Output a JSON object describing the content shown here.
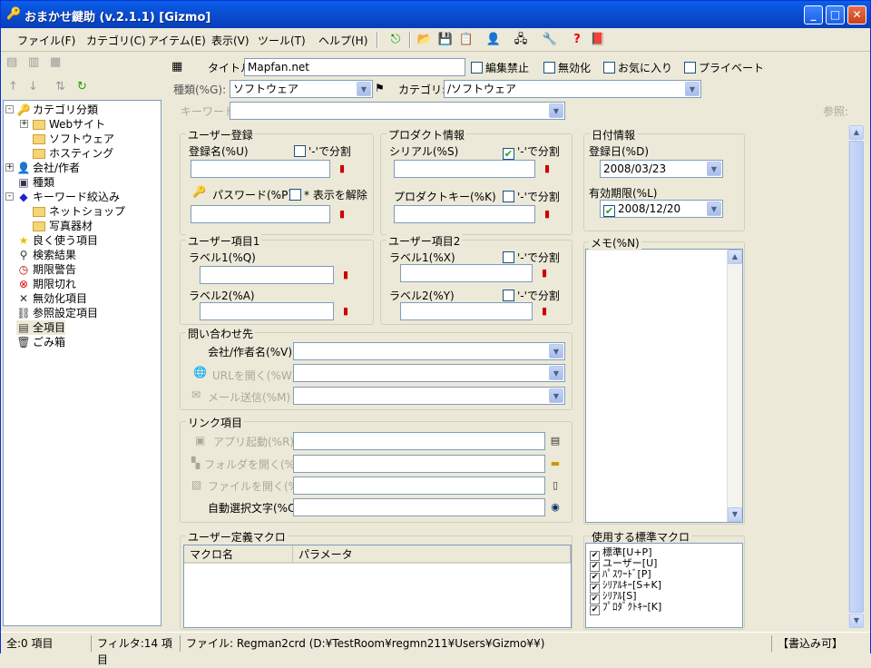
{
  "window": {
    "title": "おまかせ鍵助 (v.2.1.1) [Gizmo]"
  },
  "menu": [
    "ファイル(F)",
    "カテゴリ(C)",
    "アイテム(E)",
    "表示(V)",
    "ツール(T)",
    "ヘルプ(H)"
  ],
  "tree": {
    "items": [
      {
        "label": "カテゴリ分類",
        "icon": "key-icon",
        "level": 0,
        "exp": "-"
      },
      {
        "label": "Webサイト",
        "icon": "folder-icon",
        "level": 1,
        "exp": "+"
      },
      {
        "label": "ソフトウェア",
        "icon": "folder-icon",
        "level": 1
      },
      {
        "label": "ホスティング",
        "icon": "folder-icon",
        "level": 1
      },
      {
        "label": "会社/作者",
        "icon": "person-icon",
        "level": 0,
        "exp": "+"
      },
      {
        "label": "種類",
        "icon": "card-icon",
        "level": 0
      },
      {
        "label": "キーワード絞込み",
        "icon": "tag-icon",
        "level": 0,
        "exp": "-"
      },
      {
        "label": "ネットショップ",
        "icon": "folder-icon",
        "level": 1
      },
      {
        "label": "写真器材",
        "icon": "folder-icon",
        "level": 1
      },
      {
        "label": "良く使う項目",
        "icon": "star-icon",
        "level": 0
      },
      {
        "label": "検索結果",
        "icon": "binoculars-icon",
        "level": 0
      },
      {
        "label": "期限警告",
        "icon": "clock-icon",
        "level": 0
      },
      {
        "label": "期限切れ",
        "icon": "expired-icon",
        "level": 0
      },
      {
        "label": "無効化項目",
        "icon": "cross-icon",
        "level": 0
      },
      {
        "label": "参照設定項目",
        "icon": "link-icon",
        "level": 0
      },
      {
        "label": "全項目",
        "icon": "pages-icon",
        "level": 0
      },
      {
        "label": "ごみ箱",
        "icon": "trash-icon",
        "level": 0
      }
    ]
  },
  "top": {
    "title_label": "タイトル(%T):",
    "title_value": "Mapfan.net",
    "lock_label": "編集禁止",
    "disable_label": "無効化",
    "fav_label": "お気に入り",
    "private_label": "プライベート",
    "type_label": "種類(%G):",
    "type_value": "ソフトウェア",
    "cat_label": "カテゴリ:",
    "cat_value": "/ソフトウェア",
    "kw_label": "キーワード",
    "ref_label": "参照:"
  },
  "user": {
    "group": "ユーザー登録",
    "name_label": "登録名(%U)",
    "split_label": "'-'で分割",
    "pw_label": "パスワード(%P)",
    "mask_label": "* 表示を解除"
  },
  "product": {
    "group": "プロダクト情報",
    "serial_label": "シリアル(%S)",
    "split_label": "'-'で分割",
    "pkey_label": "プロダクトキー(%K)",
    "split2_label": "'-'で分割"
  },
  "date": {
    "group": "日付情報",
    "reg_label": "登録日(%D)",
    "reg_value": "2008/03/23",
    "exp_label": "有効期限(%L)",
    "exp_value": "2008/12/20"
  },
  "uitem1": {
    "group": "ユーザー項目1",
    "l1": "ラベル1(%Q)",
    "l2": "ラベル2(%A)"
  },
  "uitem2": {
    "group": "ユーザー項目2",
    "l1": "ラベル1(%X)",
    "l2": "ラベル2(%Y)",
    "split": "'-'で分割"
  },
  "memo": {
    "label": "メモ(%N)"
  },
  "contact": {
    "group": "問い合わせ先",
    "company_label": "会社/作者名(%V):",
    "url_label": "URLを開く(%W)",
    "mail_label": "メール送信(%M)"
  },
  "link": {
    "group": "リンク項目",
    "app_label": "アプリ起動(%R)",
    "folder_label": "フォルダを開く(%F)",
    "file_label": "ファイルを開く(%O)",
    "auto_label": "自動選択文字(%C):"
  },
  "macro": {
    "group": "ユーザー定義マクロ",
    "col_name": "マクロ名",
    "col_param": "パラメータ"
  },
  "std": {
    "group": "使用する標準マクロ",
    "items": [
      "標準[U+P]",
      "ユーザー[U]",
      "ﾊﾟｽﾜｰﾄﾞ[P]",
      "ｼﾘｱﾙｷｰ[S+K]",
      "ｼﾘｱﾙ[S]",
      "ﾌﾟﾛﾀﾞｸﾄｷｰ[K]"
    ]
  },
  "status": {
    "total": "全:0 項目",
    "filter": "フィルタ:14 項目",
    "file": "ファイル:  Regman2crd (D:¥TestRoom¥regmn211¥Users¥Gizmo¥¥)",
    "write": "【書込み可】"
  }
}
